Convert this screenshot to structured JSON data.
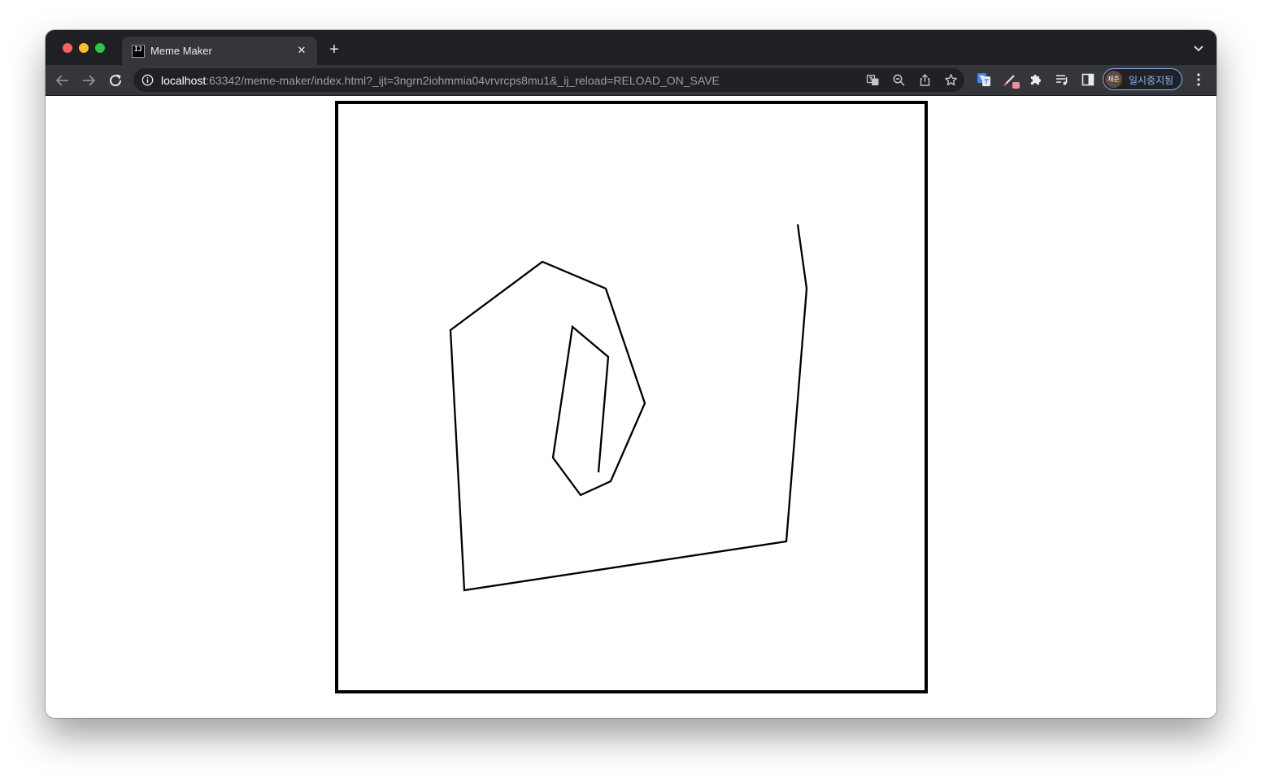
{
  "browser": {
    "tab": {
      "title": "Meme Maker",
      "favicon_text": "IJ",
      "close_icon": "close-icon"
    },
    "new_tab_icon": "plus-icon",
    "tab_search_icon": "chevron-down-icon",
    "toolbar": {
      "back_icon": "arrow-left-icon",
      "forward_icon": "arrow-right-icon",
      "reload_icon": "reload-icon"
    },
    "address_bar": {
      "host": "localhost",
      "rest": ":63342/meme-maker/index.html?_ijt=3ngrn2iohmmia04vrvrcps8mu1&_ij_reload=RELOAD_ON_SAVE"
    },
    "omnibox_actions": [
      "translate-icon",
      "zoom-icon",
      "share-icon",
      "bookmark-star-icon"
    ],
    "extensions": [
      "google-translate-icon",
      "pen-extension-icon",
      "puzzle-icon",
      "reading-list-icon",
      "side-panel-icon"
    ],
    "profile": {
      "avatar_text": "재준",
      "label": "일시중지됨"
    },
    "menu_icon": "kebab-menu-icon"
  },
  "drawing": {
    "stroke_color": "#000000",
    "background": "#ffffff",
    "border_color": "#000000"
  }
}
